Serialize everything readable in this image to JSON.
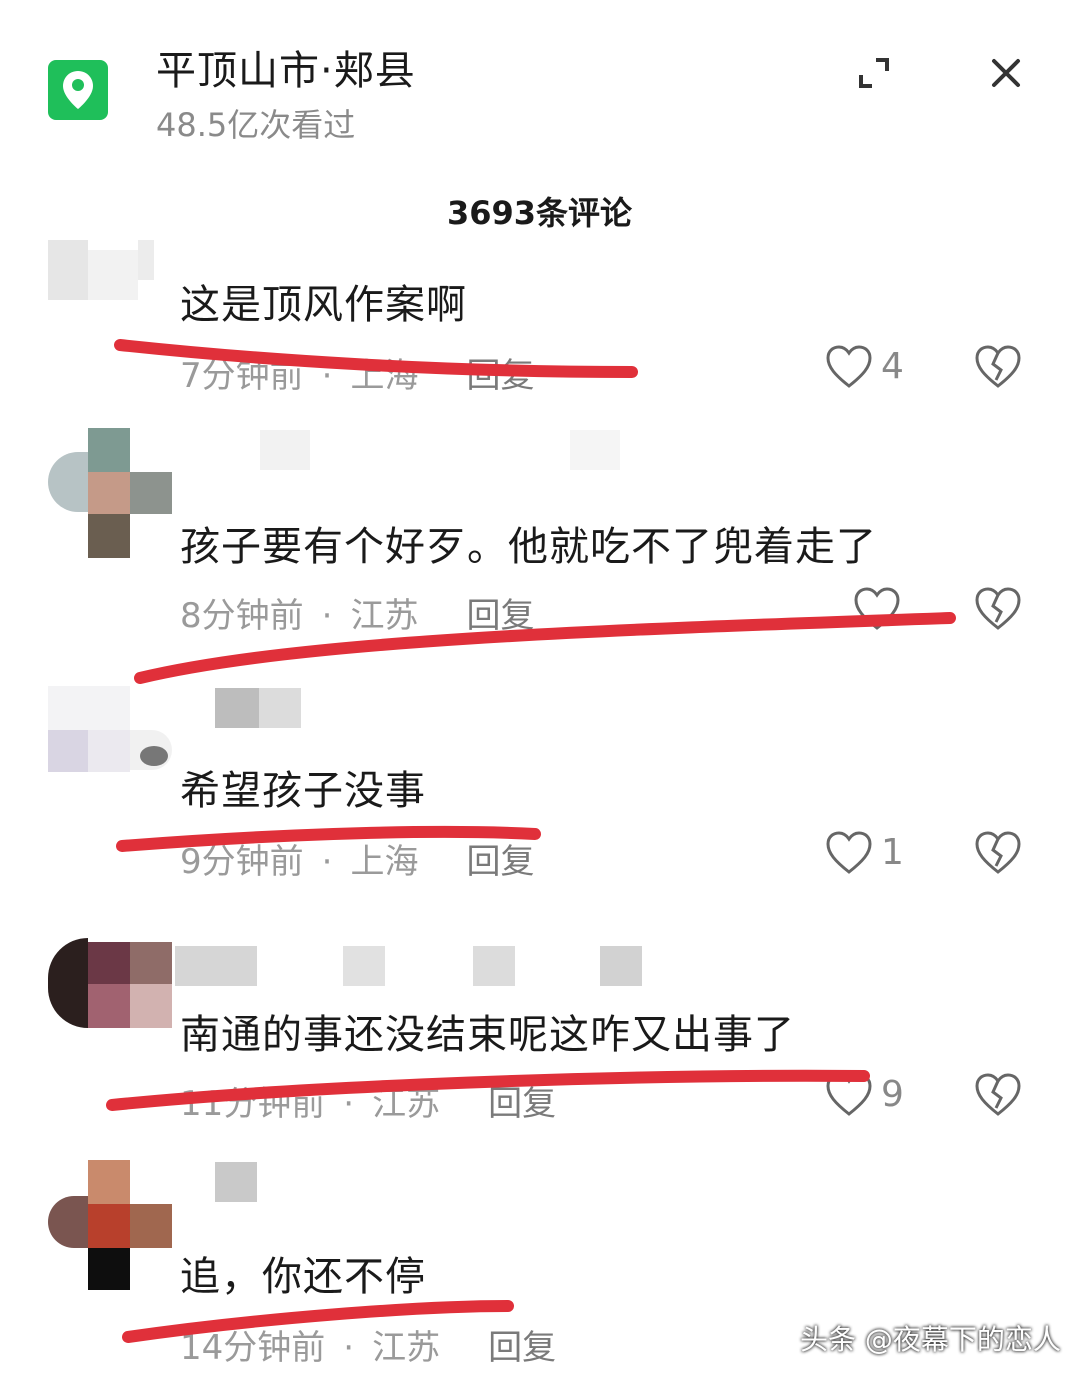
{
  "header": {
    "location_title": "平顶山市·郏县",
    "views": "48.5亿次看过",
    "icon_color": "#1fbf5a"
  },
  "comment_count": "3693条评论",
  "comments": [
    {
      "text": "这是顶风作案啊",
      "time": "7分钟前",
      "region": "上海",
      "reply": "回复",
      "likes": "4"
    },
    {
      "text": "孩子要有个好歹。他就吃不了兜着走了",
      "time": "8分钟前",
      "region": "江苏",
      "reply": "回复",
      "likes": ""
    },
    {
      "text": "希望孩子没事",
      "time": "9分钟前",
      "region": "上海",
      "reply": "回复",
      "likes": "1"
    },
    {
      "text": "南通的事还没结束呢这咋又出事了",
      "time": "11分钟前",
      "region": "江苏",
      "reply": "回复",
      "likes": "9"
    },
    {
      "text": "追，你还不停",
      "time": "14分钟前",
      "region": "江苏",
      "reply": "回复",
      "likes": ""
    }
  ],
  "watermark": "头条 @夜幕下的恋人",
  "icons": {
    "location": "location-pin-icon",
    "expand": "expand-icon",
    "close": "close-icon",
    "like": "heart-icon",
    "dislike": "broken-heart-icon"
  },
  "highlight_color": "#e0303a"
}
